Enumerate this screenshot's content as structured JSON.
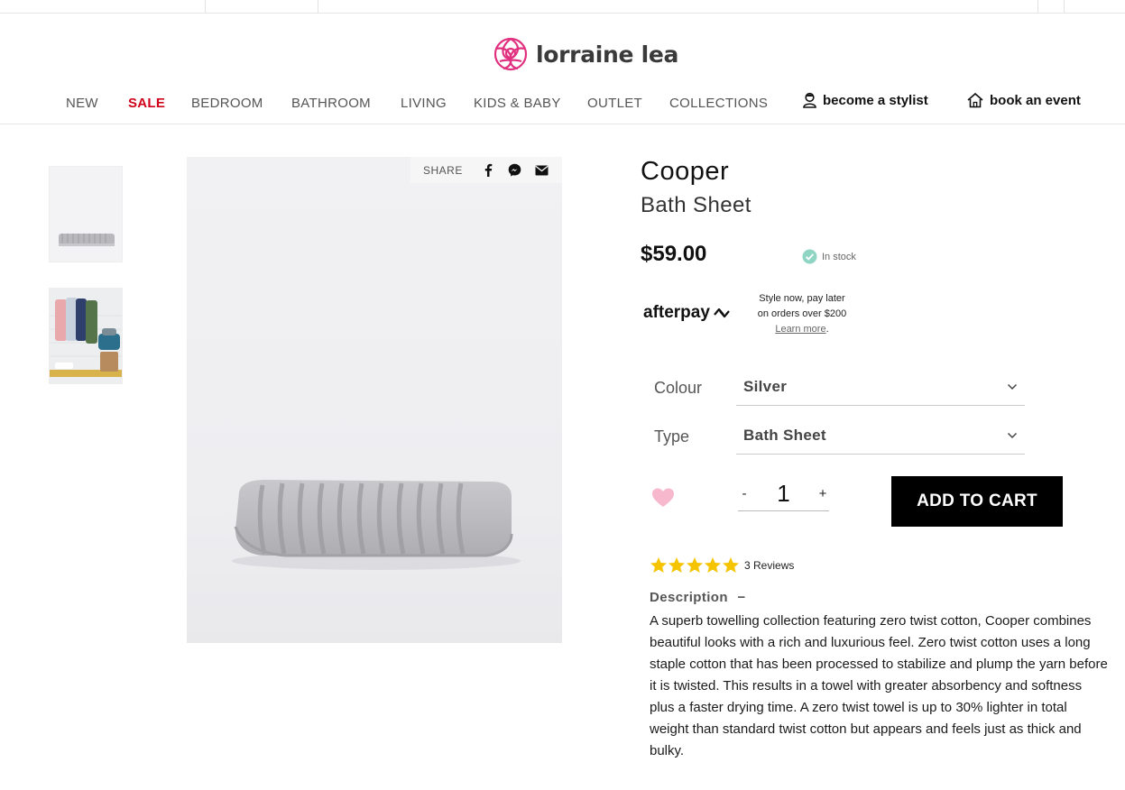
{
  "brand": {
    "name": "lorraine lea",
    "accent": "#e0307f"
  },
  "nav": {
    "items": [
      "NEW",
      "SALE",
      "BEDROOM",
      "BATHROOM",
      "LIVING",
      "KIDS & BABY",
      "OUTLET",
      "COLLECTIONS"
    ],
    "sale_color": "#d0021b",
    "stylist": "become a stylist",
    "event": "book an event"
  },
  "gallery": {
    "thumbs": [
      "grey folded towel",
      "coloured towels on hooks"
    ]
  },
  "share": {
    "label": "SHARE",
    "icons": [
      "facebook-icon",
      "messenger-icon",
      "email-icon"
    ]
  },
  "product": {
    "title": "Cooper",
    "subtitle": "Bath Sheet",
    "price": "$59.00",
    "stock": "In stock"
  },
  "afterpay": {
    "logo": "afterpay",
    "line1": "Style now, pay later",
    "line2": "on orders over $200",
    "learn_more": "Learn more",
    "period": "."
  },
  "options": {
    "colour_label": "Colour",
    "colour_value": "Silver",
    "type_label": "Type",
    "type_value": "Bath Sheet"
  },
  "cart": {
    "minus": "-",
    "quantity": "1",
    "plus": "+",
    "add_label": "ADD TO CART"
  },
  "reviews": {
    "rating": 5,
    "max": 5,
    "count_label": "3 Reviews",
    "star_color": "#f5c400"
  },
  "description": {
    "heading": "Description",
    "toggle": "−",
    "text": "A superb towelling collection featuring zero twist cotton, Cooper combines beautiful looks with a rich and luxurious feel. Zero twist cotton uses a long staple cotton that has been processed to stabilize and plump the yarn before it is twisted. This results in a towel with greater absorbency and softness plus a faster drying time. A zero twist towel is up to 30% lighter in total weight than standard twist cotton but appears and feels just as thick and bulky."
  }
}
